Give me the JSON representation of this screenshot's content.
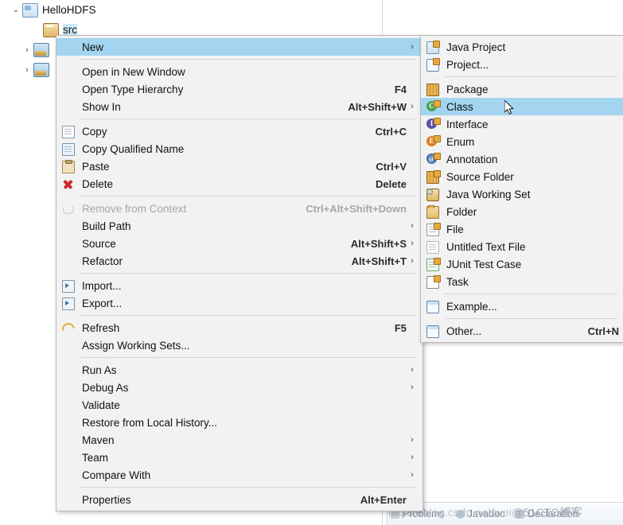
{
  "tree": {
    "items": [
      {
        "label": "HelloHDFS",
        "icon": "java-project-icon",
        "twisty": "v",
        "indent": 12,
        "selected": false
      },
      {
        "label": "src",
        "icon": "source-folder-icon",
        "twisty": "",
        "indent": 38,
        "selected": true
      },
      {
        "label": "",
        "icon": "library-icon",
        "twisty": ">",
        "indent": 26,
        "selected": false
      },
      {
        "label": "",
        "icon": "library-icon",
        "twisty": ">",
        "indent": 26,
        "selected": false
      }
    ]
  },
  "context_menu": {
    "name": "project-context-menu",
    "groups": [
      {
        "items": [
          {
            "label": "New",
            "accel": "",
            "arrow": "›",
            "icon": "",
            "highlighted": true,
            "disabled": false
          }
        ]
      },
      {
        "items": [
          {
            "label": "Open in New Window",
            "accel": "",
            "arrow": "",
            "icon": "",
            "highlighted": false,
            "disabled": false
          },
          {
            "label": "Open Type Hierarchy",
            "accel": "F4",
            "arrow": "",
            "icon": "",
            "highlighted": false,
            "disabled": false
          },
          {
            "label": "Show In",
            "accel": "Alt+Shift+W",
            "arrow": "›",
            "icon": "",
            "highlighted": false,
            "disabled": false
          }
        ]
      },
      {
        "items": [
          {
            "label": "Copy",
            "accel": "Ctrl+C",
            "arrow": "",
            "icon": "copy-icon",
            "highlighted": false,
            "disabled": false
          },
          {
            "label": "Copy Qualified Name",
            "accel": "",
            "arrow": "",
            "icon": "copy-qualified-name-icon",
            "highlighted": false,
            "disabled": false
          },
          {
            "label": "Paste",
            "accel": "Ctrl+V",
            "arrow": "",
            "icon": "paste-icon",
            "highlighted": false,
            "disabled": false
          },
          {
            "label": "Delete",
            "accel": "Delete",
            "arrow": "",
            "icon": "delete-icon",
            "highlighted": false,
            "disabled": false
          }
        ]
      },
      {
        "items": [
          {
            "label": "Remove from Context",
            "accel": "Ctrl+Alt+Shift+Down",
            "arrow": "",
            "icon": "remove-from-context-icon",
            "highlighted": false,
            "disabled": true
          },
          {
            "label": "Build Path",
            "accel": "",
            "arrow": "›",
            "icon": "",
            "highlighted": false,
            "disabled": false
          },
          {
            "label": "Source",
            "accel": "Alt+Shift+S",
            "arrow": "›",
            "icon": "",
            "highlighted": false,
            "disabled": false
          },
          {
            "label": "Refactor",
            "accel": "Alt+Shift+T",
            "arrow": "›",
            "icon": "",
            "highlighted": false,
            "disabled": false
          }
        ]
      },
      {
        "items": [
          {
            "label": "Import...",
            "accel": "",
            "arrow": "",
            "icon": "import-icon",
            "highlighted": false,
            "disabled": false
          },
          {
            "label": "Export...",
            "accel": "",
            "arrow": "",
            "icon": "export-icon",
            "highlighted": false,
            "disabled": false
          }
        ]
      },
      {
        "items": [
          {
            "label": "Refresh",
            "accel": "F5",
            "arrow": "",
            "icon": "refresh-icon",
            "highlighted": false,
            "disabled": false
          },
          {
            "label": "Assign Working Sets...",
            "accel": "",
            "arrow": "",
            "icon": "",
            "highlighted": false,
            "disabled": false
          }
        ]
      },
      {
        "items": [
          {
            "label": "Run As",
            "accel": "",
            "arrow": "›",
            "icon": "",
            "highlighted": false,
            "disabled": false
          },
          {
            "label": "Debug As",
            "accel": "",
            "arrow": "›",
            "icon": "",
            "highlighted": false,
            "disabled": false
          },
          {
            "label": "Validate",
            "accel": "",
            "arrow": "",
            "icon": "",
            "highlighted": false,
            "disabled": false
          },
          {
            "label": "Restore from Local History...",
            "accel": "",
            "arrow": "",
            "icon": "",
            "highlighted": false,
            "disabled": false
          },
          {
            "label": "Maven",
            "accel": "",
            "arrow": "›",
            "icon": "",
            "highlighted": false,
            "disabled": false
          },
          {
            "label": "Team",
            "accel": "",
            "arrow": "›",
            "icon": "",
            "highlighted": false,
            "disabled": false
          },
          {
            "label": "Compare With",
            "accel": "",
            "arrow": "›",
            "icon": "",
            "highlighted": false,
            "disabled": false
          }
        ]
      },
      {
        "items": [
          {
            "label": "Properties",
            "accel": "Alt+Enter",
            "arrow": "",
            "icon": "",
            "highlighted": false,
            "disabled": false
          }
        ]
      }
    ]
  },
  "new_submenu": {
    "name": "new-submenu",
    "groups": [
      {
        "items": [
          {
            "label": "Java Project",
            "accel": "",
            "icon": "java-project-icon",
            "highlighted": false
          },
          {
            "label": "Project...",
            "accel": "",
            "icon": "project-icon",
            "highlighted": false
          }
        ]
      },
      {
        "items": [
          {
            "label": "Package",
            "accel": "",
            "icon": "package-icon",
            "highlighted": false
          },
          {
            "label": "Class",
            "accel": "",
            "icon": "class-icon",
            "highlighted": true
          },
          {
            "label": "Interface",
            "accel": "",
            "icon": "interface-icon",
            "highlighted": false
          },
          {
            "label": "Enum",
            "accel": "",
            "icon": "enum-icon",
            "highlighted": false
          },
          {
            "label": "Annotation",
            "accel": "",
            "icon": "annotation-icon",
            "highlighted": false
          },
          {
            "label": "Source Folder",
            "accel": "",
            "icon": "source-folder-icon",
            "highlighted": false
          },
          {
            "label": "Java Working Set",
            "accel": "",
            "icon": "java-working-set-icon",
            "highlighted": false
          },
          {
            "label": "Folder",
            "accel": "",
            "icon": "folder-icon",
            "highlighted": false
          },
          {
            "label": "File",
            "accel": "",
            "icon": "file-icon",
            "highlighted": false
          },
          {
            "label": "Untitled Text File",
            "accel": "",
            "icon": "untitled-text-file-icon",
            "highlighted": false
          },
          {
            "label": "JUnit Test Case",
            "accel": "",
            "icon": "junit-test-case-icon",
            "highlighted": false
          },
          {
            "label": "Task",
            "accel": "",
            "icon": "task-icon",
            "highlighted": false
          }
        ]
      },
      {
        "items": [
          {
            "label": "Example...",
            "accel": "",
            "icon": "example-icon",
            "highlighted": false
          }
        ]
      },
      {
        "items": [
          {
            "label": "Other...",
            "accel": "Ctrl+N",
            "icon": "other-icon",
            "highlighted": false
          }
        ]
      }
    ]
  },
  "bottom_tabs": [
    {
      "label": "Problems",
      "icon": "problems-icon"
    },
    {
      "label": "Javadoc",
      "icon": "javadoc-icon"
    },
    {
      "label": "Declaration",
      "icon": "declaration-icon"
    }
  ],
  "watermark": {
    "url": "https://blog.csdn.net/wei",
    "id": "@51CTO博客"
  },
  "colors": {
    "menu_background": "#f2f2f2",
    "menu_border": "#b9b9b9",
    "highlight": "#a3d4f0",
    "tree_selection": "#cde8f7",
    "disabled_text": "#a6a6a6"
  }
}
